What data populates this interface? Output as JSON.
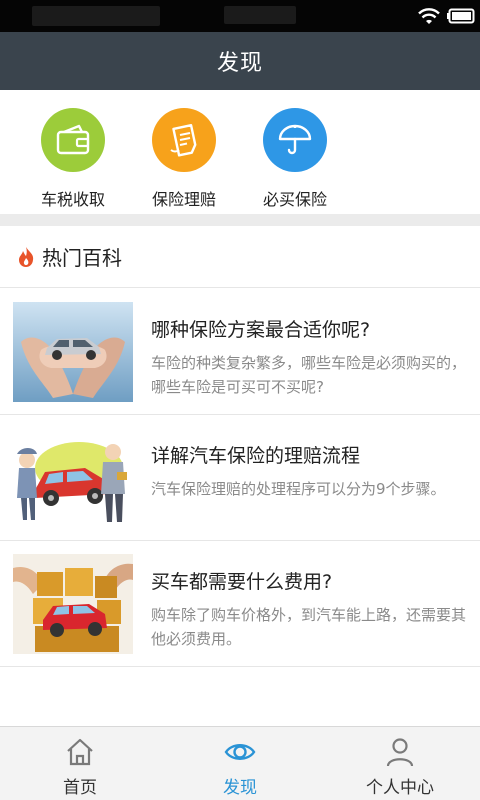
{
  "page": {
    "title": "发现"
  },
  "quick_menu": [
    {
      "label": "车税收取",
      "icon": "wallet-icon",
      "color": "#9ccc3a"
    },
    {
      "label": "保险理赔",
      "icon": "document-icon",
      "color": "#f7a21b"
    },
    {
      "label": "必买保险",
      "icon": "umbrella-icon",
      "color": "#2e97e6"
    }
  ],
  "section": {
    "title": "热门百科",
    "icon": "flame-icon",
    "icon_color": "#e8542a"
  },
  "articles": [
    {
      "title": "哪种保险方案最合适你呢?",
      "desc": "车险的种类复杂繁多，哪些车险是必须购买的，哪些车险是可买可不买呢?",
      "image": "hands-holding-car-image"
    },
    {
      "title": "详解汽车保险的理赔流程",
      "desc": "汽车保险理赔的处理程序可以分为9个步骤。",
      "image": "car-accident-cartoon-image"
    },
    {
      "title": "买车都需要什么费用?",
      "desc": "购车除了购车价格外，到汽车能上路，还需要其他必须费用。",
      "image": "tax-blocks-car-image"
    }
  ],
  "tabs": [
    {
      "label": "首页",
      "icon": "home-icon",
      "active": false
    },
    {
      "label": "发现",
      "icon": "eye-icon",
      "active": true
    },
    {
      "label": "个人中心",
      "icon": "person-icon",
      "active": false
    }
  ],
  "colors": {
    "title_bar": "#3a444d",
    "active_tab": "#2a93d5",
    "inactive_tab": "#7a7a7a"
  }
}
